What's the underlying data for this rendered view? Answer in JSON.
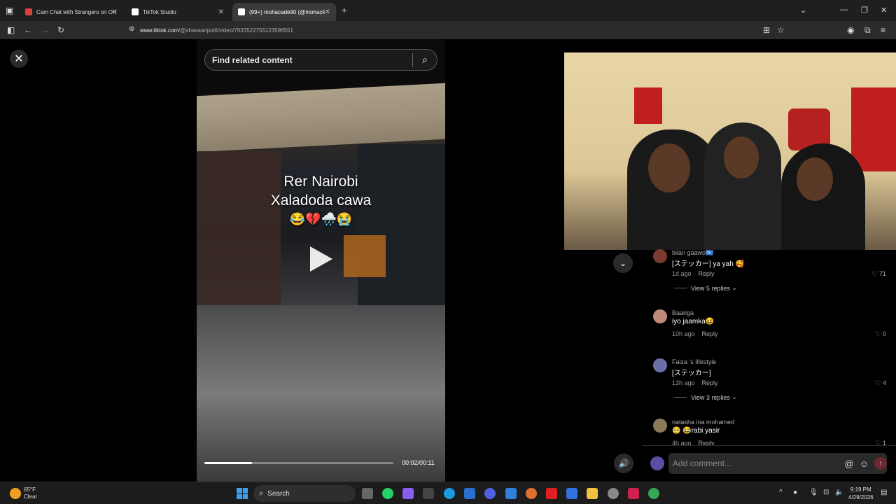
{
  "browser": {
    "tabs": [
      {
        "title": "Cam Chat with Strangers on On",
        "favicon_color": "#d94040",
        "active": false
      },
      {
        "title": "TikTok Studio",
        "favicon_color": "#ffffff",
        "active": false
      },
      {
        "title": "(99+) mohacade90 (@mohacli",
        "favicon_color": "#ffffff",
        "active": true
      }
    ],
    "new_tab": "+",
    "url_host": "www.tiktok.com",
    "url_path": "/@shaxaaripoi6/video/7633522755123596551"
  },
  "video": {
    "search_placeholder": "Find related content",
    "caption_line1": "Rer Nairobi",
    "caption_line2": "Xaladoda cawa",
    "caption_emoji": "😂💔🌧️😭",
    "time": "00:02/00:11",
    "progress": 0.25
  },
  "comments": [
    {
      "user": "bilan gaawo🇸🇴",
      "text": "[ステッカー] ya yah 🥰",
      "time": "1d ago",
      "reply": "Reply",
      "likes": "71",
      "avatar_color": "#7a3b2e",
      "view_replies": "View 5 replies"
    },
    {
      "user": "Baariga",
      "text": "iyo jaamka😆",
      "time": "10h ago",
      "reply": "Reply",
      "likes": "0",
      "avatar_color": "#c08a7a"
    },
    {
      "user": "Faiza 's lifestyle",
      "text": "[ステッカー]",
      "time": "13h ago",
      "reply": "Reply",
      "likes": "4",
      "avatar_color": "#6b6fa8",
      "view_replies": "View 3 replies"
    },
    {
      "user": "natasha ina mohamed",
      "text": "🥺 😂rabi yasir",
      "time": "4h ago",
      "reply": "Reply",
      "likes": "1",
      "avatar_color": "#8a7a5a"
    }
  ],
  "comment_input": {
    "placeholder": "Add comment..."
  },
  "taskbar": {
    "temp": "65°F",
    "condition": "Clear",
    "search": "Search",
    "time": "9:19 PM",
    "date": "4/29/2026"
  },
  "icons": {
    "close": "close-icon",
    "search": "search-icon",
    "chevron": "chevron-down-icon",
    "volume": "volume-icon",
    "send": "send-icon"
  }
}
